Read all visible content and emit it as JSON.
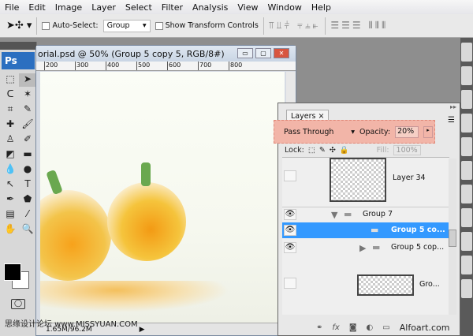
{
  "menu": [
    "File",
    "Edit",
    "Image",
    "Layer",
    "Select",
    "Filter",
    "Analysis",
    "View",
    "Window",
    "Help"
  ],
  "options": {
    "tool_icon": "move-tool-icon",
    "auto_select_label": "Auto-Select:",
    "auto_select_value": "Group",
    "show_transform_label": "Show Transform Controls"
  },
  "toolbox": {
    "logo": "Ps"
  },
  "document": {
    "title": "orial.psd @ 50% (Group 5 copy 5, RGB/8#)",
    "ruler": [
      "200",
      "300",
      "400",
      "500",
      "600",
      "700",
      "800"
    ],
    "status": "1.65M/96.2M",
    "watermark": "思缘设计论坛 www.MISSYUAN.COM"
  },
  "layers": {
    "tab": "Layers",
    "close": "×",
    "blend_mode": "Pass Through",
    "opacity_label": "Opacity:",
    "opacity_value": "20%",
    "lock_label": "Lock:",
    "fill_label": "Fill:",
    "fill_value": "100%",
    "items": [
      {
        "name": "Layer 34",
        "visible": false
      },
      {
        "name": "Group 7",
        "visible": true
      },
      {
        "name": "Group 5 co...",
        "visible": true,
        "selected": true
      },
      {
        "name": "Group 5 cop...",
        "visible": true
      },
      {
        "name": "Gro...",
        "visible": false
      }
    ],
    "footer_watermark": "Alfoart.com"
  },
  "colors": {
    "selection": "#3399ff",
    "highlight": "#f2b5a8",
    "ps_blue": "#2b6fc0"
  }
}
